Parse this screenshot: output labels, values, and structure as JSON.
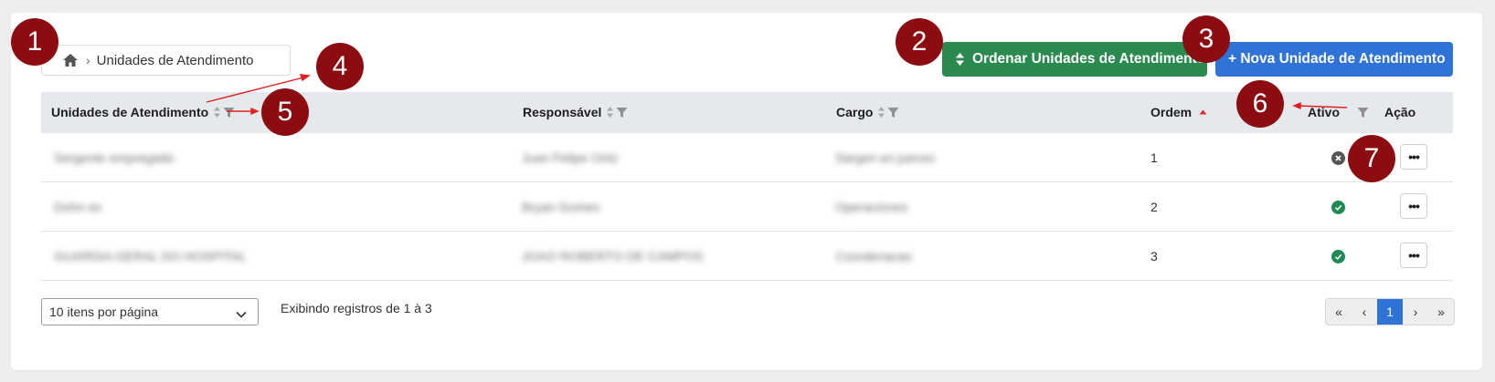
{
  "breadcrumb": {
    "home_icon": "home-icon",
    "separator": "›",
    "current": "Unidades de Atendimento"
  },
  "toolbar": {
    "order_label": "Ordenar Unidades de Atendimento",
    "order_icon": "sort-icon",
    "new_label": "+ Nova Unidade de Atendimento",
    "order_color": "#2b8a4f",
    "new_color": "#2f73d7"
  },
  "table": {
    "headers": {
      "unit": "Unidades de Atendimento",
      "responsible": "Responsável",
      "role": "Cargo",
      "order": "Ordem",
      "active": "Ativo",
      "action": "Ação"
    },
    "rows": [
      {
        "unit": "Sergente empregado",
        "responsible": "Juan Felipe Ortiz",
        "role": "Sargen en jueces",
        "order": "1",
        "active": false,
        "action": "•••"
      },
      {
        "unit": "Dohn es",
        "responsible": "Bryan Gomes",
        "role": "Operaciones",
        "order": "2",
        "active": true,
        "action": "•••"
      },
      {
        "unit": "GUARDIA GERAL DO HOSPITAL",
        "responsible": "JOAO ROBERTO DE CAMPOS",
        "role": "Coordenacao",
        "order": "3",
        "active": true,
        "action": "•••"
      }
    ]
  },
  "footer": {
    "per_page": "10 itens por página",
    "showing": "Exibindo registros de 1 à 3",
    "pagination": {
      "first": "«",
      "prev": "‹",
      "current": "1",
      "next": "›",
      "last": "»"
    }
  },
  "annotations": [
    "1",
    "2",
    "3",
    "4",
    "5",
    "6",
    "7"
  ],
  "colors": {
    "marker": "#8b0d12",
    "inactive": "#555555",
    "active": "#1f8a53",
    "sort_asc": "#d93030"
  }
}
